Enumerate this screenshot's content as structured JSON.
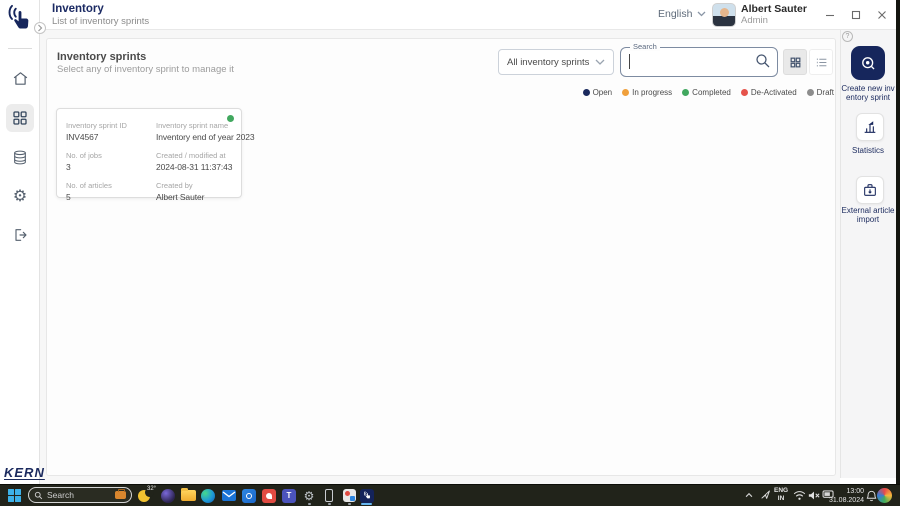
{
  "topbar": {
    "app_title": "Inventory",
    "app_subtitle": "List of inventory sprints",
    "language": "English",
    "user_name": "Albert Sauter",
    "user_role": "Admin"
  },
  "sidebar": {
    "icons": [
      "home",
      "apps-grid",
      "database",
      "settings",
      "logout"
    ],
    "active": "apps-grid"
  },
  "main": {
    "heading": "Inventory sprints",
    "subheading": "Select any of inventory sprint to manage it",
    "filter_selected": "All inventory sprints",
    "search_label": "Search",
    "search_value": "",
    "legend": [
      {
        "label": "Open",
        "color": "#1b2a5e"
      },
      {
        "label": "In progress",
        "color": "#f0a03c"
      },
      {
        "label": "Completed",
        "color": "#41a85f"
      },
      {
        "label": "De-Activated",
        "color": "#e5534b"
      },
      {
        "label": "Draft",
        "color": "#8d8d8d"
      }
    ],
    "card": {
      "status": "Completed",
      "status_color": "#41a85f",
      "fields": [
        {
          "label": "Inventory sprint ID",
          "value": "INV4567"
        },
        {
          "label": "Inventory sprint name",
          "value": "Inventory end of year 2023"
        },
        {
          "label": "No. of jobs",
          "value": "3"
        },
        {
          "label": "Created / modified at",
          "value": "2024-08-31 11:37:43"
        },
        {
          "label": "No. of articles",
          "value": "5"
        },
        {
          "label": "Created by",
          "value": "Albert Sauter"
        }
      ]
    }
  },
  "actions": {
    "items": [
      {
        "label": "Create new inventory sprint"
      },
      {
        "label": "Statistics"
      },
      {
        "label": "External article import"
      }
    ]
  },
  "footer": {
    "brand": "KERN"
  },
  "taskbar": {
    "search_placeholder": "Search",
    "weather_temp": "32°",
    "tray": {
      "lang_top": "ENG",
      "lang_bottom": "IN",
      "time": "13:00",
      "date": "31.08.2024"
    }
  },
  "icons": {
    "gear_glyph": "⚙",
    "help_glyph": "?"
  },
  "colors": {
    "accent_navy": "#16265c",
    "taskbar_accent": "#66b6f0"
  }
}
